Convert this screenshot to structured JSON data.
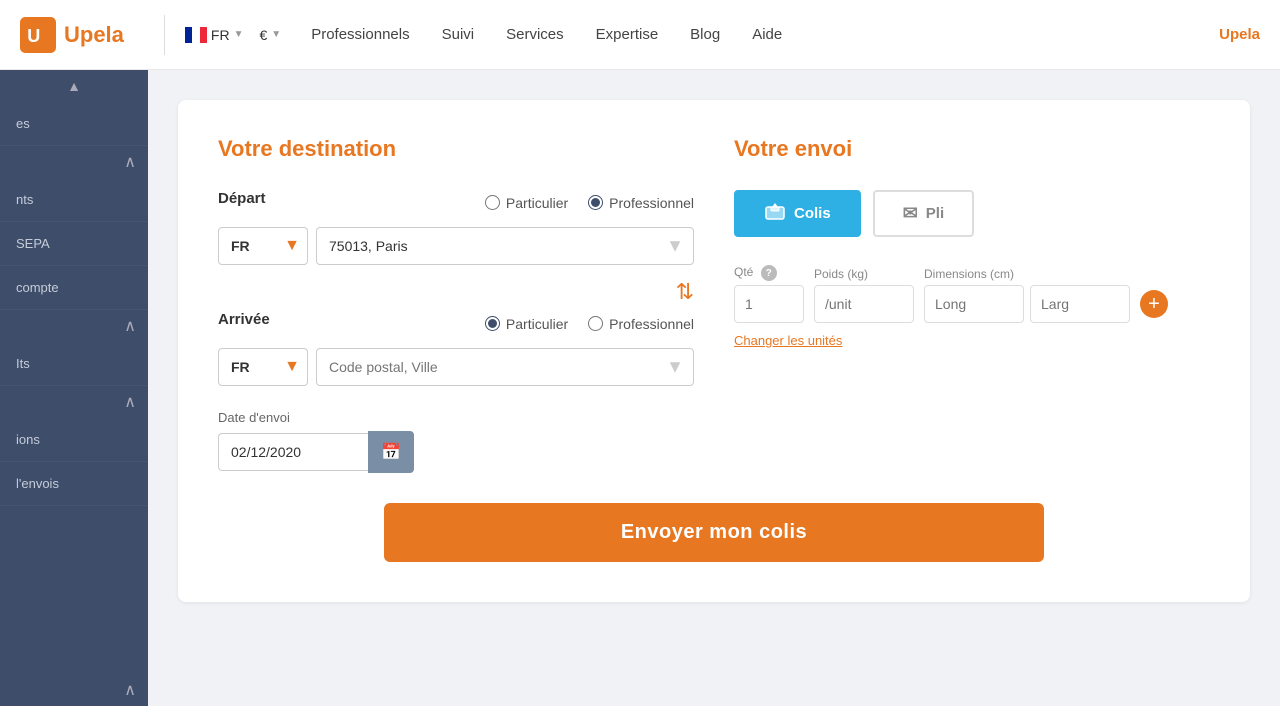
{
  "header": {
    "logo_text": "Upela",
    "lang": "FR",
    "currency": "€",
    "nav": [
      {
        "label": "Professionnels",
        "id": "nav-pro"
      },
      {
        "label": "Suivi",
        "id": "nav-suivi"
      },
      {
        "label": "Services",
        "id": "nav-services"
      },
      {
        "label": "Expertise",
        "id": "nav-expertise"
      },
      {
        "label": "Blog",
        "id": "nav-blog"
      },
      {
        "label": "Aide",
        "id": "nav-aide"
      }
    ],
    "user_label": "Upela"
  },
  "sidebar": {
    "items": [
      {
        "label": "es",
        "has_sub": false
      },
      {
        "label": "nts",
        "has_sub": true,
        "arrow": "∧"
      },
      {
        "label": "SEPA",
        "has_sub": false
      },
      {
        "label": "compte",
        "has_sub": false
      },
      {
        "label": "Its",
        "has_sub": true,
        "arrow": "∧"
      },
      {
        "label": "ions",
        "has_sub": true,
        "arrow": "∧"
      },
      {
        "label": "l'envois",
        "has_sub": false
      }
    ],
    "scroll_up": "▲",
    "collapse": "∧"
  },
  "destination": {
    "title": "Votre destination",
    "depart_label": "Départ",
    "depart_particulier": "Particulier",
    "depart_professionnel": "Professionnel",
    "depart_country": "FR",
    "depart_city": "75013, Paris",
    "depart_city_placeholder": "Code postal, Ville",
    "swap_icon": "⇅",
    "arrivee_label": "Arrivée",
    "arrivee_particulier": "Particulier",
    "arrivee_professionnel": "Professionnel",
    "arrivee_country": "FR",
    "arrivee_city_placeholder": "Code postal, Ville",
    "date_label": "Date d'envoi",
    "date_value": "02/12/2020",
    "date_placeholder": "02/12/2020"
  },
  "envoi": {
    "title": "Votre envoi",
    "tab_colis": "Colis",
    "tab_pli": "Pli",
    "qty_label": "Qté",
    "poids_label": "Poids (kg)",
    "dimensions_label": "Dimensions (cm)",
    "qty_placeholder": "1",
    "poids_placeholder": "/unit",
    "long_placeholder": "Long",
    "larg_placeholder": "Larg",
    "changer_label": "Changer les unités",
    "add_label": "+"
  },
  "submit": {
    "label": "Envoyer mon colis"
  },
  "icons": {
    "colis": "📦",
    "pli": "✉",
    "calendar": "📅",
    "swap": "⇅"
  }
}
